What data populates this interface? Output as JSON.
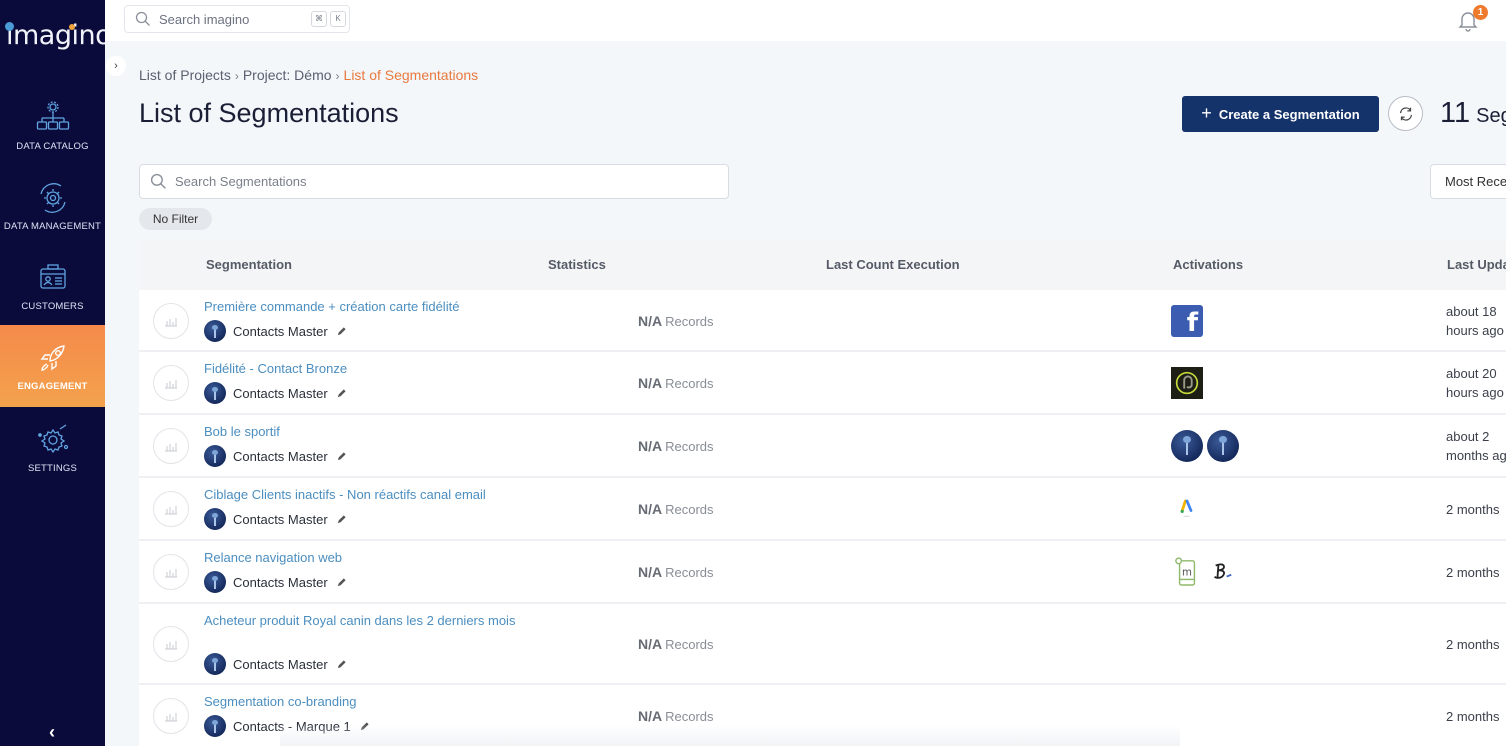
{
  "app": {
    "name": "imagino"
  },
  "sidebar": {
    "items": [
      {
        "label": "DATA CATALOG",
        "icon": "data-catalog-icon",
        "active": false
      },
      {
        "label": "DATA MANAGEMENT",
        "icon": "data-management-icon",
        "active": false
      },
      {
        "label": "CUSTOMERS",
        "icon": "customers-icon",
        "active": false
      },
      {
        "label": "ENGAGEMENT",
        "icon": "rocket-icon",
        "active": true
      },
      {
        "label": "SETTINGS",
        "icon": "settings-icon",
        "active": false
      }
    ],
    "collapse_icon": "chevron-left-icon"
  },
  "topbar": {
    "search_placeholder": "Search imagino",
    "shortcut_keys": [
      "⌘",
      "K"
    ],
    "notifications_count": "1"
  },
  "breadcrumb": {
    "items": [
      "List of Projects",
      "Project: Démo",
      "List of Segmentations"
    ],
    "separator": "›"
  },
  "page": {
    "title": "List of Segmentations",
    "create_button_label": "Create a Segmentation",
    "segmentation_count": "11",
    "segmentation_count_unit": "Segmentations",
    "search_placeholder": "Search Segmentations",
    "sort_selected": "Most Recent",
    "filter_chip": "No Filter"
  },
  "colors": {
    "sidebar_bg": "#0b0b3b",
    "active_nav": "#f58a4b",
    "primary_button": "#15336b",
    "link": "#4b8ec0",
    "breadcrumb_current": "#e8793f",
    "badge": "#ee7a2d"
  },
  "table": {
    "columns": [
      "Segmentation",
      "Statistics",
      "Last Count Execution",
      "Activations",
      "Last Updated"
    ],
    "rows": [
      {
        "name": "Première commande + création carte fidélité",
        "source": "Contacts Master",
        "records_value": "N/A",
        "records_label": "Records",
        "last_count": "",
        "activations": [
          "facebook"
        ],
        "updated": [
          "about 18",
          "hours ago"
        ]
      },
      {
        "name": "Fidélité - Contact Bronze",
        "source": "Contacts Master",
        "records_value": "N/A",
        "records_label": "Records",
        "last_count": "",
        "activations": [
          "pj"
        ],
        "updated": [
          "about 20",
          "hours ago"
        ]
      },
      {
        "name": "Bob le sportif",
        "source": "Contacts Master",
        "records_value": "N/A",
        "records_label": "Records",
        "last_count": "",
        "activations": [
          "imagino",
          "imagino"
        ],
        "updated": [
          "about 2",
          "months ago"
        ]
      },
      {
        "name": "Ciblage Clients inactifs - Non réactifs canal email",
        "source": "Contacts Master",
        "records_value": "N/A",
        "records_label": "Records",
        "last_count": "",
        "activations": [
          "google-ads"
        ],
        "updated": [
          "2 months"
        ]
      },
      {
        "name": "Relance navigation web",
        "source": "Contacts Master",
        "records_value": "N/A",
        "records_label": "Records",
        "last_count": "",
        "activations": [
          "mobile-m",
          "b-signature"
        ],
        "updated": [
          "2 months"
        ]
      },
      {
        "name": "Acheteur produit Royal canin dans les 2 derniers mois",
        "source": "Contacts Master",
        "records_value": "N/A",
        "records_label": "Records",
        "last_count": "",
        "activations": [],
        "updated": [
          "2 months"
        ]
      },
      {
        "name": "Segmentation co-branding",
        "source": "Contacts - Marque 1",
        "records_value": "N/A",
        "records_label": "Records",
        "last_count": "",
        "activations": [],
        "updated": [
          "2 months"
        ]
      }
    ]
  }
}
